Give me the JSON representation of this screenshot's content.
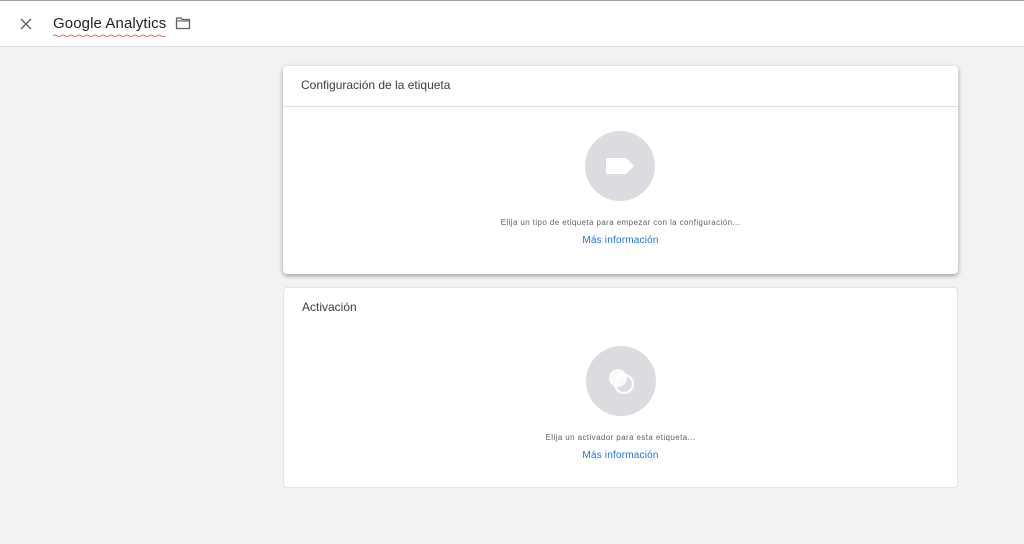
{
  "header": {
    "title": "Google Analytics",
    "close_icon": "close-icon",
    "folder_icon": "folder-icon"
  },
  "tag_configuration": {
    "title": "Configuración de la etiqueta",
    "icon": "tag-icon",
    "hint": "Elija un tipo de etiqueta para empezar con la configuración...",
    "link": "Más información"
  },
  "triggering": {
    "title": "Activación",
    "icon": "trigger-icon",
    "hint": "Elija un activador para esta etiqueta...",
    "link": "Más información"
  },
  "colors": {
    "link": "#1a73e8",
    "icon_bg": "#dadce0",
    "background": "#f1f2f4"
  }
}
